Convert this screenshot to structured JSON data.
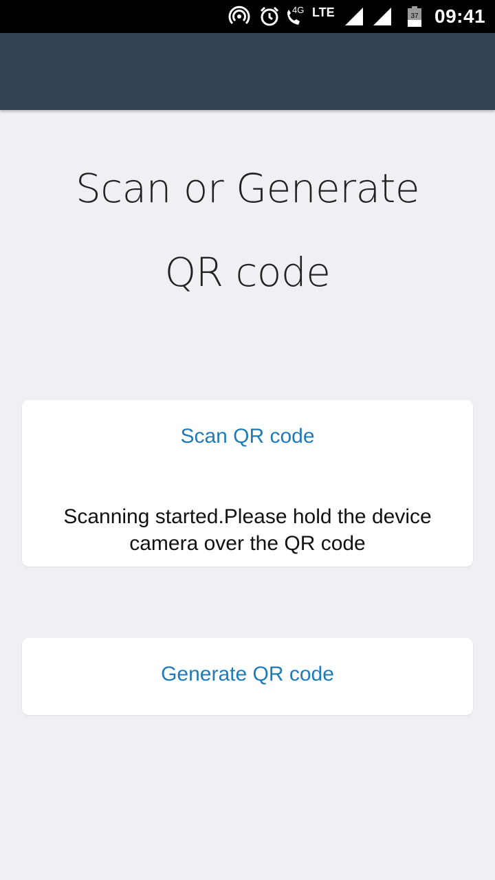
{
  "status_bar": {
    "network_4g": "4G",
    "network_lte": "LTE",
    "battery_level": "37",
    "time": "09:41",
    "icons": [
      "hotspot-icon",
      "alarm-icon",
      "volte-call-icon",
      "signal-icon",
      "signal-icon",
      "battery-icon"
    ]
  },
  "main": {
    "heading_line1": "Scan or Generate",
    "heading_line2": "QR code",
    "scan_button_label": "Scan QR code",
    "scan_status": "Scanning started.Please hold the device camera over the QR code",
    "generate_button_label": "Generate QR code"
  },
  "colors": {
    "app_bar": "#334455",
    "background": "#efeff4",
    "link": "#1f7bb8"
  }
}
